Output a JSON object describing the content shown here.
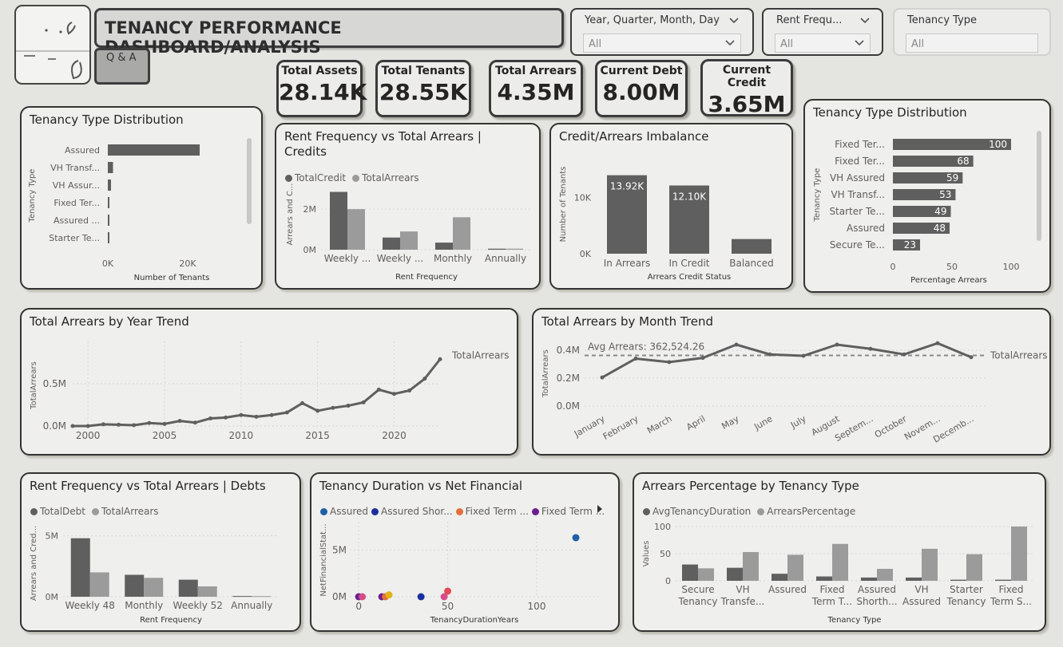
{
  "header": {
    "title": "TENANCY PERFORMANCE DASHBOARD/ANALYSIS",
    "qa_label": "Q & A"
  },
  "slicers": [
    {
      "label": "Year, Quarter, Month, Day",
      "value": "All"
    },
    {
      "label": "Rent Frequ...",
      "value": "All"
    },
    {
      "label": "Tenancy Type",
      "value": "All"
    }
  ],
  "kpis": [
    {
      "title": "Total Assets",
      "value": "28.14K"
    },
    {
      "title": "Total Tenants",
      "value": "28.55K"
    },
    {
      "title": "Total Arrears",
      "value": "4.35M"
    },
    {
      "title": "Current Debt",
      "value": "8.00M"
    },
    {
      "title": "Current Credit",
      "value": "3.65M"
    }
  ],
  "colors": {
    "dark": "#5f5f5f",
    "light": "#9b9b9b",
    "grid": "#d6d6d6"
  },
  "chart_data": [
    {
      "id": "tenancy_type_count",
      "type": "bar",
      "orientation": "horizontal",
      "title": "Tenancy Type Distribution",
      "categories": [
        "Assured",
        "VH Transf...",
        "VH Assur...",
        "Fixed Ter...",
        "Assured ...",
        "Starter Te..."
      ],
      "values": [
        23000,
        1300,
        800,
        300,
        200,
        200
      ],
      "xlabel": "Number of Tenants",
      "ylabel": "Tenancy Type",
      "xticks": [
        "0K",
        "20K"
      ],
      "xlim": [
        0,
        30000
      ]
    },
    {
      "id": "rent_freq_credit",
      "type": "bar",
      "title": "Rent Frequency vs Total Arrears | Credits",
      "categories": [
        "Weekly ...",
        "Weekly ...",
        "Monthly",
        "Annually"
      ],
      "series": [
        {
          "name": "TotalCredit",
          "values": [
            2850000,
            600000,
            350000,
            50000
          ]
        },
        {
          "name": "TotalArrears",
          "values": [
            2000000,
            900000,
            1600000,
            50000
          ]
        }
      ],
      "xlabel": "Rent Frequency",
      "ylabel": "Arrears and C...",
      "yticks": [
        "0M",
        "2M"
      ],
      "ylim": [
        0,
        3500000
      ]
    },
    {
      "id": "credit_arrears_imbalance",
      "type": "bar",
      "title": "Credit/Arrears Imbalance",
      "categories": [
        "In Arrears",
        "In Credit",
        "Balanced"
      ],
      "values": [
        13920,
        12100,
        2600
      ],
      "data_labels": [
        "13.92K",
        "12.10K",
        ""
      ],
      "xlabel": "Arrears Credit Status",
      "ylabel": "Number of Tenants",
      "yticks": [
        "0K",
        "10K"
      ],
      "ylim": [
        0,
        15000
      ]
    },
    {
      "id": "tenancy_type_pct",
      "type": "bar",
      "orientation": "horizontal",
      "title": "Tenancy Type Distribution",
      "categories": [
        "Fixed Ter...",
        "Fixed Ter...",
        "VH Assured",
        "VH Transf...",
        "Starter Te...",
        "Assured",
        "Secure Te..."
      ],
      "values": [
        100,
        68,
        59,
        53,
        49,
        48,
        23
      ],
      "xlabel": "Percentage Arrears",
      "ylabel": "Tenancy Type",
      "xticks": [
        "0",
        "50",
        "100"
      ],
      "xlim": [
        0,
        100
      ]
    },
    {
      "id": "arrears_year",
      "type": "line",
      "title": "Total Arrears by Year Trend",
      "x": [
        1999,
        2000,
        2001,
        2002,
        2003,
        2004,
        2005,
        2006,
        2007,
        2008,
        2009,
        2010,
        2011,
        2012,
        2013,
        2014,
        2015,
        2016,
        2017,
        2018,
        2019,
        2020,
        2021,
        2022,
        2023
      ],
      "series": [
        {
          "name": "TotalArrears",
          "values": [
            0,
            0,
            20000,
            15000,
            10000,
            35000,
            25000,
            60000,
            40000,
            90000,
            100000,
            130000,
            110000,
            130000,
            160000,
            270000,
            180000,
            215000,
            240000,
            280000,
            430000,
            380000,
            420000,
            560000,
            790000
          ]
        }
      ],
      "ylabel": "TotalArrears",
      "xticks": [
        "2000",
        "2005",
        "2010",
        "2015",
        "2020"
      ],
      "yticks": [
        "0.0M",
        "0.5M"
      ],
      "ylim": [
        0,
        1000000
      ]
    },
    {
      "id": "arrears_month",
      "type": "line",
      "title": "Total Arrears by Month Trend",
      "categories": [
        "January",
        "February",
        "March",
        "April",
        "May",
        "June",
        "July",
        "August",
        "Septem...",
        "October",
        "Novem...",
        "Decemb..."
      ],
      "series": [
        {
          "name": "TotalArrears",
          "values": [
            205000,
            340000,
            315000,
            345000,
            440000,
            370000,
            360000,
            440000,
            410000,
            370000,
            450000,
            350000
          ]
        }
      ],
      "reference_line": {
        "label": "Avg Arrears: 362,524.26",
        "value": 362524.26
      },
      "ylabel": "TotalArrears",
      "yticks": [
        "0.0M",
        "0.2M",
        "0.4M"
      ],
      "ylim": [
        0,
        450000
      ]
    },
    {
      "id": "rent_freq_debt",
      "type": "bar",
      "title": "Rent Frequency vs Total Arrears | Debts",
      "categories": [
        "Weekly 48",
        "Monthly",
        "Weekly 52",
        "Annually"
      ],
      "series": [
        {
          "name": "TotalDebt",
          "values": [
            4800000,
            1800000,
            1400000,
            60000
          ]
        },
        {
          "name": "TotalArrears",
          "values": [
            2000000,
            1550000,
            850000,
            50000
          ]
        }
      ],
      "xlabel": "Rent Frequency",
      "ylabel": "Arrears and Cred...",
      "yticks": [
        "0M",
        "5M"
      ],
      "ylim": [
        0,
        5500000
      ]
    },
    {
      "id": "duration_vs_net",
      "type": "scatter",
      "title": "Tenancy Duration vs Net Financial",
      "legend": [
        {
          "name": "Assured",
          "color": "#1f5fa8"
        },
        {
          "name": "Assured Shor...",
          "color": "#1c2fa0"
        },
        {
          "name": "Fixed Term ...",
          "color": "#e2703a"
        },
        {
          "name": "Fixed Term ...",
          "color": "#6b1f8e"
        }
      ],
      "points": [
        {
          "x": 0,
          "y": 0,
          "color": "#6b1f8e"
        },
        {
          "x": 2,
          "y": 0,
          "color": "#d64d8a"
        },
        {
          "x": 13,
          "y": 0,
          "color": "#6b1f8e"
        },
        {
          "x": 15,
          "y": 0,
          "color": "#e2703a"
        },
        {
          "x": 17,
          "y": 200000,
          "color": "#e0b31d"
        },
        {
          "x": 35,
          "y": 0,
          "color": "#1c2fa0"
        },
        {
          "x": 48,
          "y": 0,
          "color": "#d64d8a"
        },
        {
          "x": 50,
          "y": 600000,
          "color": "#e24a5a"
        },
        {
          "x": 122,
          "y": 6300000,
          "color": "#1f5fa8"
        }
      ],
      "xlabel": "TenancyDurationYears",
      "ylabel": "NetFinancialStat...",
      "xticks": [
        "0",
        "50",
        "100"
      ],
      "yticks": [
        "0M",
        "5M"
      ],
      "xlim": [
        -5,
        135
      ],
      "ylim": [
        0,
        8000000
      ]
    },
    {
      "id": "arrears_pct_type",
      "type": "bar",
      "title": "Arrears Percentage by Tenancy Type",
      "categories": [
        [
          "Secure",
          "Tenancy"
        ],
        [
          "VH",
          "Transfe..."
        ],
        [
          "Assured",
          ""
        ],
        [
          "Fixed",
          "Term T..."
        ],
        [
          "Assured",
          "Shorth..."
        ],
        [
          "VH",
          "Assured"
        ],
        [
          "Starter",
          "Tenancy"
        ],
        [
          "Fixed",
          "Term S..."
        ]
      ],
      "series": [
        {
          "name": "AvgTenancyDuration",
          "values": [
            30,
            24,
            13,
            8,
            6,
            6,
            2,
            2
          ]
        },
        {
          "name": "ArrearsPercentage",
          "values": [
            23,
            53,
            48,
            68,
            22,
            59,
            49,
            100
          ]
        }
      ],
      "xlabel": "Tenancy Type",
      "ylabel": "Values",
      "yticks": [
        "0",
        "50",
        "100"
      ],
      "ylim": [
        0,
        100
      ]
    }
  ]
}
